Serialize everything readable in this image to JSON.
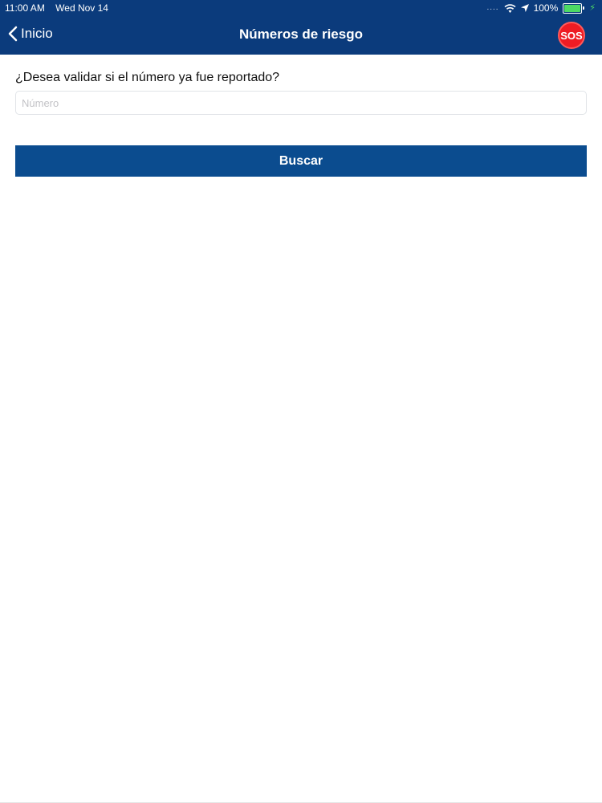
{
  "status_bar": {
    "time": "11:00 AM",
    "date": "Wed Nov 14",
    "signal_dots": "....",
    "battery_percent": "100%",
    "battery_level": 1.0,
    "icons": [
      "wifi-icon",
      "location-arrow-icon",
      "battery-icon",
      "charging-icon"
    ]
  },
  "nav": {
    "back_label": "Inicio",
    "title": "Números de riesgo",
    "sos_label": "SOS"
  },
  "form": {
    "question": "¿Desea validar si el número ya fue reportado?",
    "number_value": "",
    "number_placeholder": "Número",
    "search_label": "Buscar"
  },
  "colors": {
    "header": "#0b3b7c",
    "button": "#0b4c8f",
    "sos": "#ee1c24",
    "battery": "#4cd964"
  }
}
